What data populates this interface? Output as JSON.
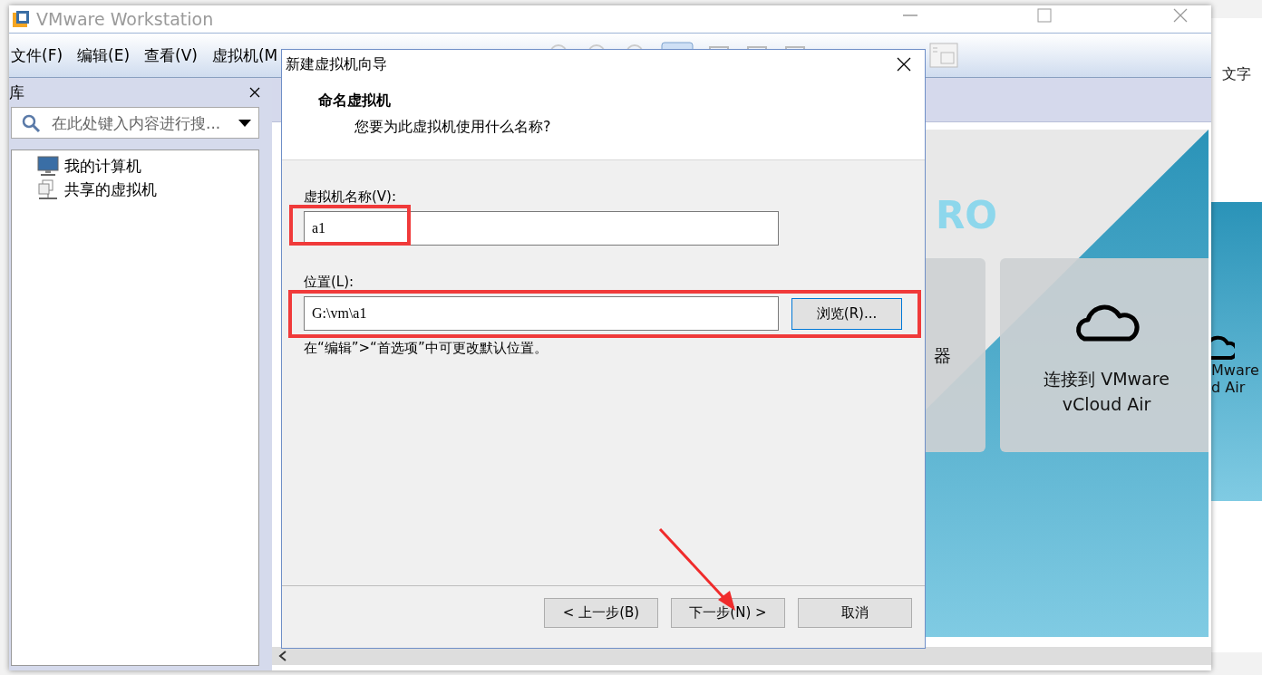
{
  "background_page": {
    "side_label": "文字",
    "side_card_lines": [
      "Mware",
      "d Air"
    ]
  },
  "window": {
    "title": "VMware Workstation"
  },
  "menu": [
    "文件(F)",
    "编辑(E)",
    "查看(V)",
    "虚拟机(M"
  ],
  "library": {
    "title": "库",
    "search": {
      "placeholder": "在此处键入内容进行搜..."
    },
    "tree": [
      {
        "label": "我的计算机",
        "kind": "computer"
      },
      {
        "label": "共享的虚拟机",
        "kind": "shared"
      }
    ]
  },
  "home": {
    "logo_text": "RO",
    "cards": [
      {
        "label": "器",
        "kind": "partial"
      },
      {
        "label": "连接到 VMware vCloud Air",
        "kind": "cloud"
      }
    ]
  },
  "dialog": {
    "title": "新建虚拟机向导",
    "heading": "命名虚拟机",
    "subheading": "您要为此虚拟机使用什么名称?",
    "name_label": "虚拟机名称(V):",
    "name_value": "a1",
    "location_label": "位置(L):",
    "location_value": "G:\\vm\\a1",
    "browse_button": "浏览(R)...",
    "note": "在“编辑”>“首选项”中可更改默认位置。",
    "buttons": [
      "< 上一步(B)",
      "下一步(N) >",
      "取消"
    ]
  }
}
